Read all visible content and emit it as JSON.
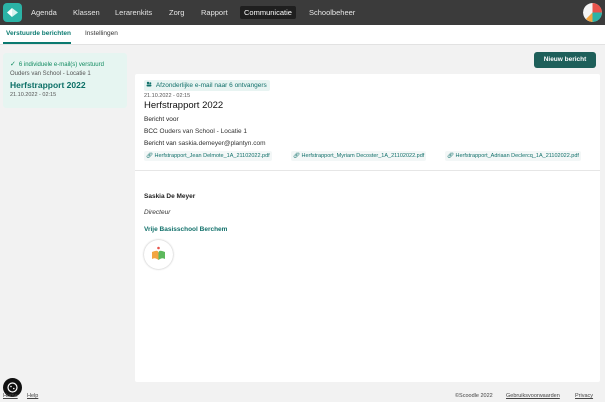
{
  "nav": {
    "items": [
      {
        "label": "Agenda",
        "active": false
      },
      {
        "label": "Klassen",
        "active": false
      },
      {
        "label": "Lerarenkits",
        "active": false
      },
      {
        "label": "Zorg",
        "active": false
      },
      {
        "label": "Rapport",
        "active": false
      },
      {
        "label": "Communicatie",
        "active": true
      },
      {
        "label": "Schoolbeheer",
        "active": false
      }
    ]
  },
  "subtabs": {
    "sent": "Verstuurde berichten",
    "settings": "Instellingen"
  },
  "sidebar": {
    "message": {
      "status": "6 individuele e-mail(s) verstuurd",
      "recipient": "Ouders van School - Locatie 1",
      "title": "Herfstrapport 2022",
      "date": "21.10.2022 - 02:15"
    }
  },
  "actions": {
    "new_message": "Nieuw bericht"
  },
  "message": {
    "badge": "Afzonderlijke e-mail naar 6 ontvangers",
    "date": "21.10.2022 - 02:15",
    "title": "Herfstrapport 2022",
    "for_label": "Bericht voor",
    "bcc_label": "BCC",
    "bcc_value": "Ouders van School - Locatie 1",
    "from_label": "Bericht van",
    "from_value": "saskia.demeyer@plantyn.com",
    "attachments": [
      "Herfstrapport_Jean Delmote_1A_21102022.pdf",
      "Herfstrapport_Myriam Decoster_1A_21102022.pdf",
      "Herfstrapport_Adriaan Declercq_1A_21102022.pdf"
    ],
    "signature": {
      "name": "Saskia De Meyer",
      "role": "Directeur",
      "school": "Vrije Basisschool Berchem"
    }
  },
  "footer": {
    "home": "Home",
    "help": "Help",
    "copyright": "©Scoodle 2022",
    "terms": "Gebruiksvoorwaarden",
    "privacy": "Privacy"
  },
  "colors": {
    "accent": "#0b7a70",
    "nav_bg": "#3b3b3b",
    "button": "#1e5f5a"
  }
}
